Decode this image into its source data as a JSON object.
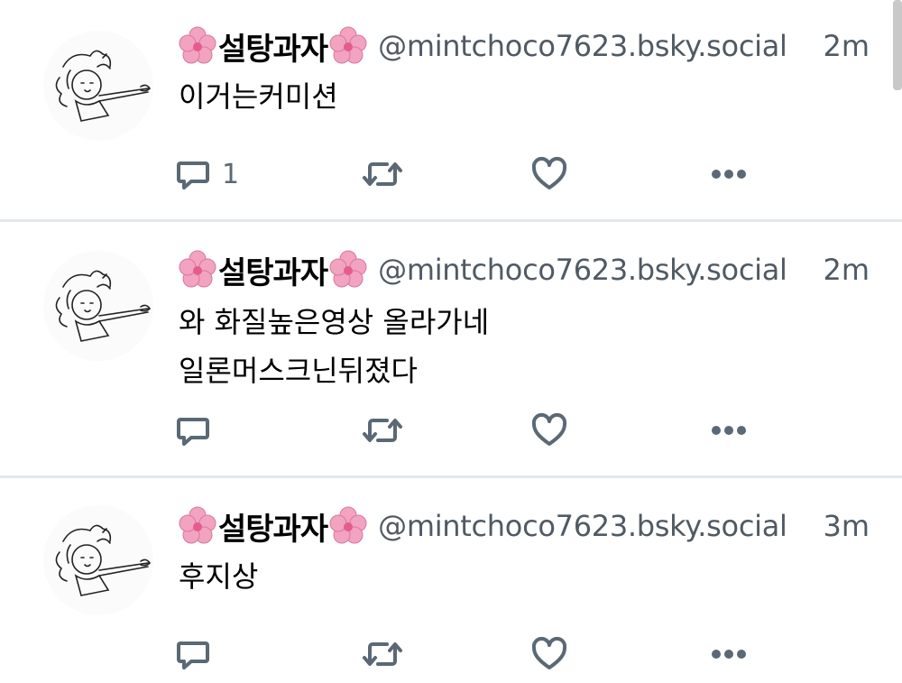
{
  "posts": [
    {
      "author": "설탕과자",
      "handle": "@mintchoco7623.bsky.social",
      "time": "2m",
      "lines": [
        "이거는커미션"
      ],
      "reply_count": "1",
      "icons": [
        "reply-icon",
        "repost-icon",
        "like-icon",
        "more-icon"
      ]
    },
    {
      "author": "설탕과자",
      "handle": "@mintchoco7623.bsky.social",
      "time": "2m",
      "lines": [
        "와 화질높은영상 올라가네",
        "일론머스크닌뒤졌다"
      ],
      "reply_count": "",
      "icons": [
        "reply-icon",
        "repost-icon",
        "like-icon",
        "more-icon"
      ]
    },
    {
      "author": "설탕과자",
      "handle": "@mintchoco7623.bsky.social",
      "time": "3m",
      "lines": [
        "후지상"
      ],
      "reply_count": "",
      "icons": [
        "reply-icon",
        "repost-icon",
        "like-icon",
        "more-icon"
      ]
    }
  ],
  "colors": {
    "secondary_text": "#505a64",
    "icon": "#5b6875",
    "divider": "#e3e7ec",
    "flower": "#f2a3c0"
  }
}
